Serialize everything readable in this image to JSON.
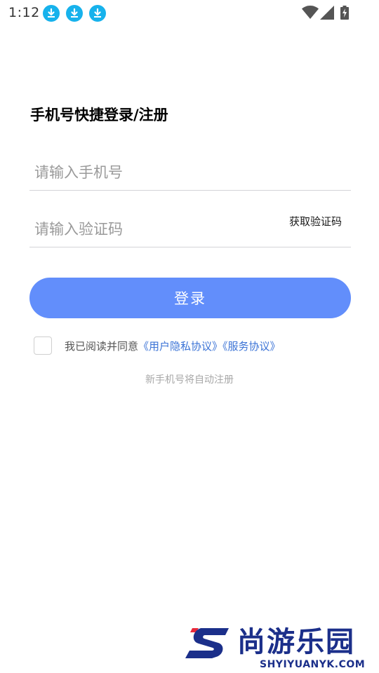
{
  "status_bar": {
    "time": "1:12",
    "notification_icons": [
      "download-icon",
      "download-icon",
      "download-icon"
    ],
    "system_icons": [
      "wifi-icon",
      "signal-icon",
      "battery-charging-icon"
    ]
  },
  "login": {
    "title": "手机号快捷登录/注册",
    "phone_placeholder": "请输入手机号",
    "phone_value": "",
    "code_placeholder": "请输入验证码",
    "code_value": "",
    "get_code_label": "获取验证码",
    "submit_label": "登录"
  },
  "agreement": {
    "checked": false,
    "text": "我已阅读并同意",
    "privacy_link": "《用户隐私协议》",
    "service_link": "《服务协议》"
  },
  "hint": "新手机号将自动注册",
  "watermark": {
    "name_cn": "尚游乐园",
    "name_en": "SHYIYUANYK.COM"
  },
  "colors": {
    "primary_button": "#628efb",
    "link": "#3b73d6",
    "notification_icon": "#17b2ec",
    "watermark": "#1b2f8a"
  }
}
